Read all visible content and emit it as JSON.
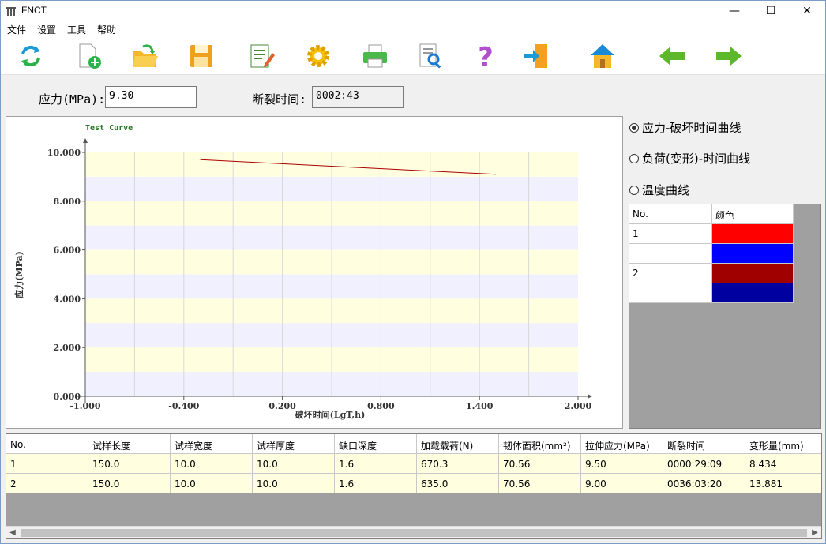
{
  "window": {
    "title": "FNCT",
    "minimize": "—",
    "maximize": "☐",
    "close": "✕"
  },
  "menu": [
    "文件",
    "设置",
    "工具",
    "帮助"
  ],
  "toolbar": [
    "refresh",
    "new-file",
    "open-folder",
    "save",
    "edit",
    "settings",
    "print",
    "preview",
    "help",
    "exit",
    "home",
    "back",
    "forward"
  ],
  "fields": {
    "stress_label": "应力(MPa):",
    "stress_value": "9.30",
    "break_label": "断裂时间:",
    "break_value": "0002:43"
  },
  "chart_data": {
    "type": "line",
    "title": "Test Curve",
    "xlabel": "破坏时间(LgT,h)",
    "ylabel": "应力(MPa)",
    "xlim": [
      -1.0,
      2.0
    ],
    "ylim": [
      0.0,
      10.0
    ],
    "xticks": [
      "-1.000",
      "-0.400",
      "0.200",
      "0.800",
      "1.400",
      "2.000"
    ],
    "yticks": [
      "0.000",
      "2.000",
      "4.000",
      "6.000",
      "8.000",
      "10.000"
    ],
    "series": [
      {
        "color": "#aa0000",
        "x": [
          -0.3,
          1.5
        ],
        "y": [
          9.7,
          9.1
        ]
      }
    ]
  },
  "radios": [
    {
      "label": "应力-破坏时间曲线",
      "checked": true
    },
    {
      "label": "负荷(变形)-时间曲线",
      "checked": false
    },
    {
      "label": "温度曲线",
      "checked": false
    }
  ],
  "color_table": {
    "headers": [
      "No.",
      "颜色"
    ],
    "rows": [
      {
        "no": "1",
        "color": "#ff0000"
      },
      {
        "no": "",
        "color": "#0000ff"
      },
      {
        "no": "2",
        "color": "#a00000"
      },
      {
        "no": "",
        "color": "#0000a0"
      }
    ]
  },
  "data_table": {
    "headers": [
      "No.",
      "试样长度",
      "试样宽度",
      "试样厚度",
      "缺口深度",
      "加载载荷(N)",
      "韧体面积(mm²)",
      "拉伸应力(MPa)",
      "断裂时间",
      "变形量(mm)"
    ],
    "rows": [
      [
        "1",
        "150.0",
        "10.0",
        "10.0",
        "1.6",
        "670.3",
        "70.56",
        "9.50",
        "0000:29:09",
        "8.434"
      ],
      [
        "2",
        "150.0",
        "10.0",
        "10.0",
        "1.6",
        "635.0",
        "70.56",
        "9.00",
        "0036:03:20",
        "13.881"
      ]
    ]
  }
}
